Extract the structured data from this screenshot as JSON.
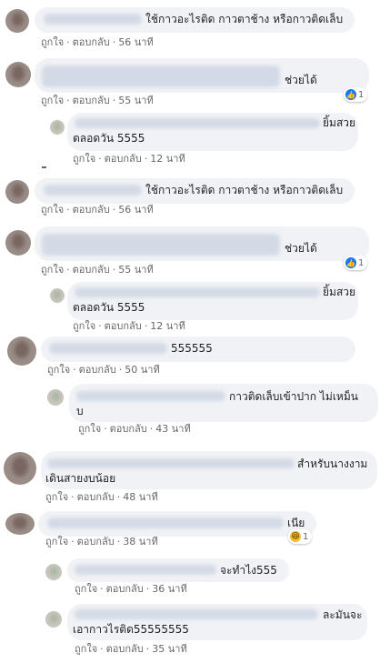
{
  "labels": {
    "like": "ถูกใจ",
    "reply": "ตอบกลับ",
    "sep": "·"
  },
  "comments": [
    {
      "lines": [
        "ใช้กาวอะไรติด กาวตาช้าง หรือกาวติดเล็บ"
      ],
      "time": "56 นาที"
    },
    {
      "lines": [
        "ช่วยได้"
      ],
      "time": "55 นาที",
      "reaction": {
        "icon": "like-icon",
        "count": "1"
      }
    },
    {
      "lines": [
        "ยิ้มสวย",
        "ตลอดวัน 5555"
      ],
      "time": "12 นาที"
    },
    {
      "lines": [
        "ใช้กาวอะไรติด กาวตาช้าง หรือกาวติดเล็บ"
      ],
      "time": "56 นาที"
    },
    {
      "lines": [
        "ช่วยได้"
      ],
      "time": "55 นาที",
      "reaction": {
        "icon": "like-icon",
        "count": "1"
      }
    },
    {
      "lines": [
        "ยิ้มสวย",
        "ตลอดวัน 5555"
      ],
      "time": "12 นาที"
    },
    {
      "lines": [
        "555555"
      ],
      "time": "50 นาที"
    },
    {
      "lines": [
        "กาวติดเล็บเข้าปาก ไม่เหม็น",
        "บ"
      ],
      "time": "43 นาที"
    },
    {
      "lines": [
        "สำหรับนางงาม",
        "เดินสายงบน้อย"
      ],
      "time": "48 นาที"
    },
    {
      "lines": [
        "เนีย"
      ],
      "time": "38 นาที",
      "reaction": {
        "icon": "haha-icon",
        "count": "1"
      }
    },
    {
      "lines": [
        "จะทำไง555"
      ],
      "time": "36 นาที"
    },
    {
      "lines": [
        "ละมันจะ",
        "เอากาวไรติด55555555"
      ],
      "time": "35 นาที"
    }
  ],
  "colors": {
    "like": "#1877f2",
    "haha": "#f7b928",
    "bubble": "#f0f2f5",
    "meta": "#65676b"
  }
}
